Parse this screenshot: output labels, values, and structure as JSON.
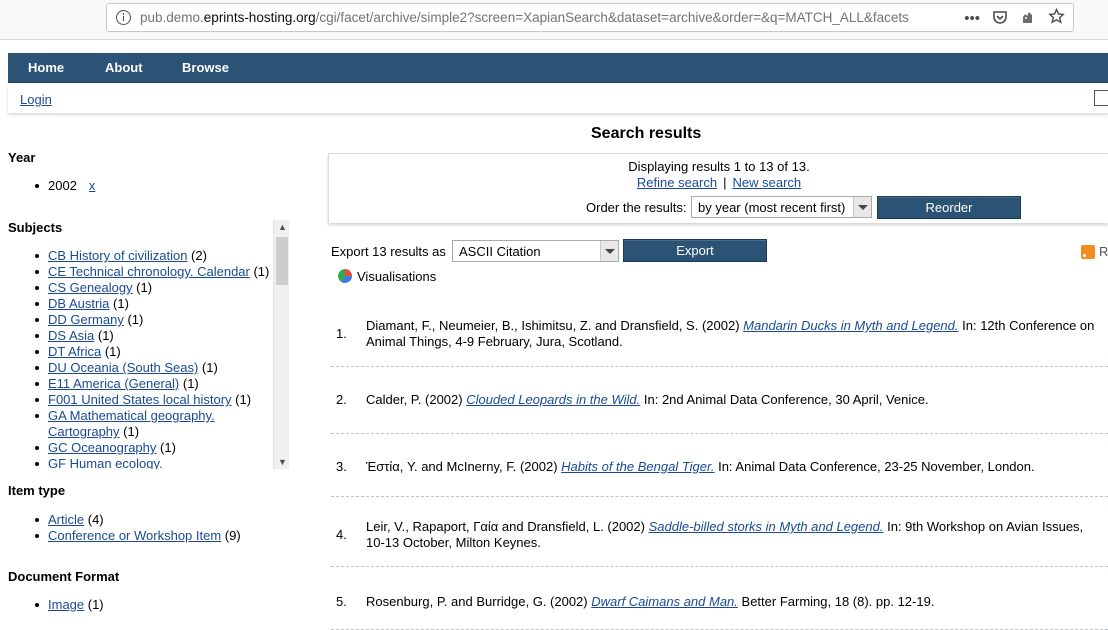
{
  "browser": {
    "url_prefix": "pub.demo.",
    "url_host": "eprints-hosting.org",
    "url_path": "/cgi/facet/archive/simple2?screen=XapianSearch&dataset=archive&order=&q=MATCH_ALL&facets",
    "menu_glyph": "•••"
  },
  "nav": {
    "home": "Home",
    "about": "About",
    "browse": "Browse",
    "login": "Login"
  },
  "sidebar": {
    "year": {
      "heading": "Year",
      "value": "2002",
      "remove": "x"
    },
    "subjects": {
      "heading": "Subjects",
      "items": [
        {
          "label": "CB History of civilization",
          "count": "(2)"
        },
        {
          "label": "CE Technical chronology. Calendar",
          "count": "(1)"
        },
        {
          "label": "CS Genealogy",
          "count": "(1)"
        },
        {
          "label": "DB Austria",
          "count": "(1)"
        },
        {
          "label": "DD Germany",
          "count": "(1)"
        },
        {
          "label": "DS Asia",
          "count": "(1)"
        },
        {
          "label": "DT Africa",
          "count": "(1)"
        },
        {
          "label": "DU Oceania (South Seas)",
          "count": "(1)"
        },
        {
          "label": "E11 America (General)",
          "count": "(1)"
        },
        {
          "label": "F001 United States local history",
          "count": "(1)"
        },
        {
          "label": "GA Mathematical geography. Cartography",
          "count": "(1)"
        },
        {
          "label": "GC Oceanography",
          "count": "(1)"
        },
        {
          "label": "GF Human ecology.",
          "count": ""
        }
      ]
    },
    "item_type": {
      "heading": "Item type",
      "items": [
        {
          "label": "Article",
          "count": "(4)"
        },
        {
          "label": "Conference or Workshop Item",
          "count": "(9)"
        }
      ]
    },
    "doc_format": {
      "heading": "Document Format",
      "items": [
        {
          "label": "Image",
          "count": "(1)"
        }
      ]
    }
  },
  "main": {
    "title": "Search results",
    "displaying": "Displaying results 1 to 13 of 13.",
    "refine": "Refine search",
    "separator": "|",
    "new_search": "New search",
    "order_label": "Order the results:",
    "order_value": "by year (most recent first)",
    "reorder": "Reorder",
    "export_label": "Export 13 results as",
    "export_format": "ASCII Citation",
    "export_button": "Export",
    "visualisations": "Visualisations",
    "rss": "R"
  },
  "results": [
    {
      "num": "1.",
      "pre": "Diamant, F., Neumeier, B., Ishimitsu, Z. and Dransfield, S. (2002) ",
      "title": "Mandarin Ducks in Myth and Legend.",
      "post": " In: 12th Conference on Animal Things, 4-9 February, Jura, Scotland."
    },
    {
      "num": "2.",
      "pre": "Calder, P. (2002) ",
      "title": "Clouded Leopards in the Wild.",
      "post": " In: 2nd Animal Data Conference, 30 April, Venice."
    },
    {
      "num": "3.",
      "pre": "Έστία, Y. and McInerny, F. (2002) ",
      "title": "Habits of the Bengal Tiger.",
      "post": " In: Animal Data Conference, 23-25 November, London."
    },
    {
      "num": "4.",
      "pre": "Leir, V., Rapaport, Γαία and Dransfield, L. (2002) ",
      "title": "Saddle-billed storks in Myth and Legend.",
      "post": " In: 9th Workshop on Avian Issues, 10-13 October, Milton Keynes."
    },
    {
      "num": "5.",
      "pre": "Rosenburg, P. and Burridge, G. (2002) ",
      "title": "Dwarf Caimans and Man.",
      "post": " Better Farming, 18 (8). pp. 12-19."
    }
  ]
}
